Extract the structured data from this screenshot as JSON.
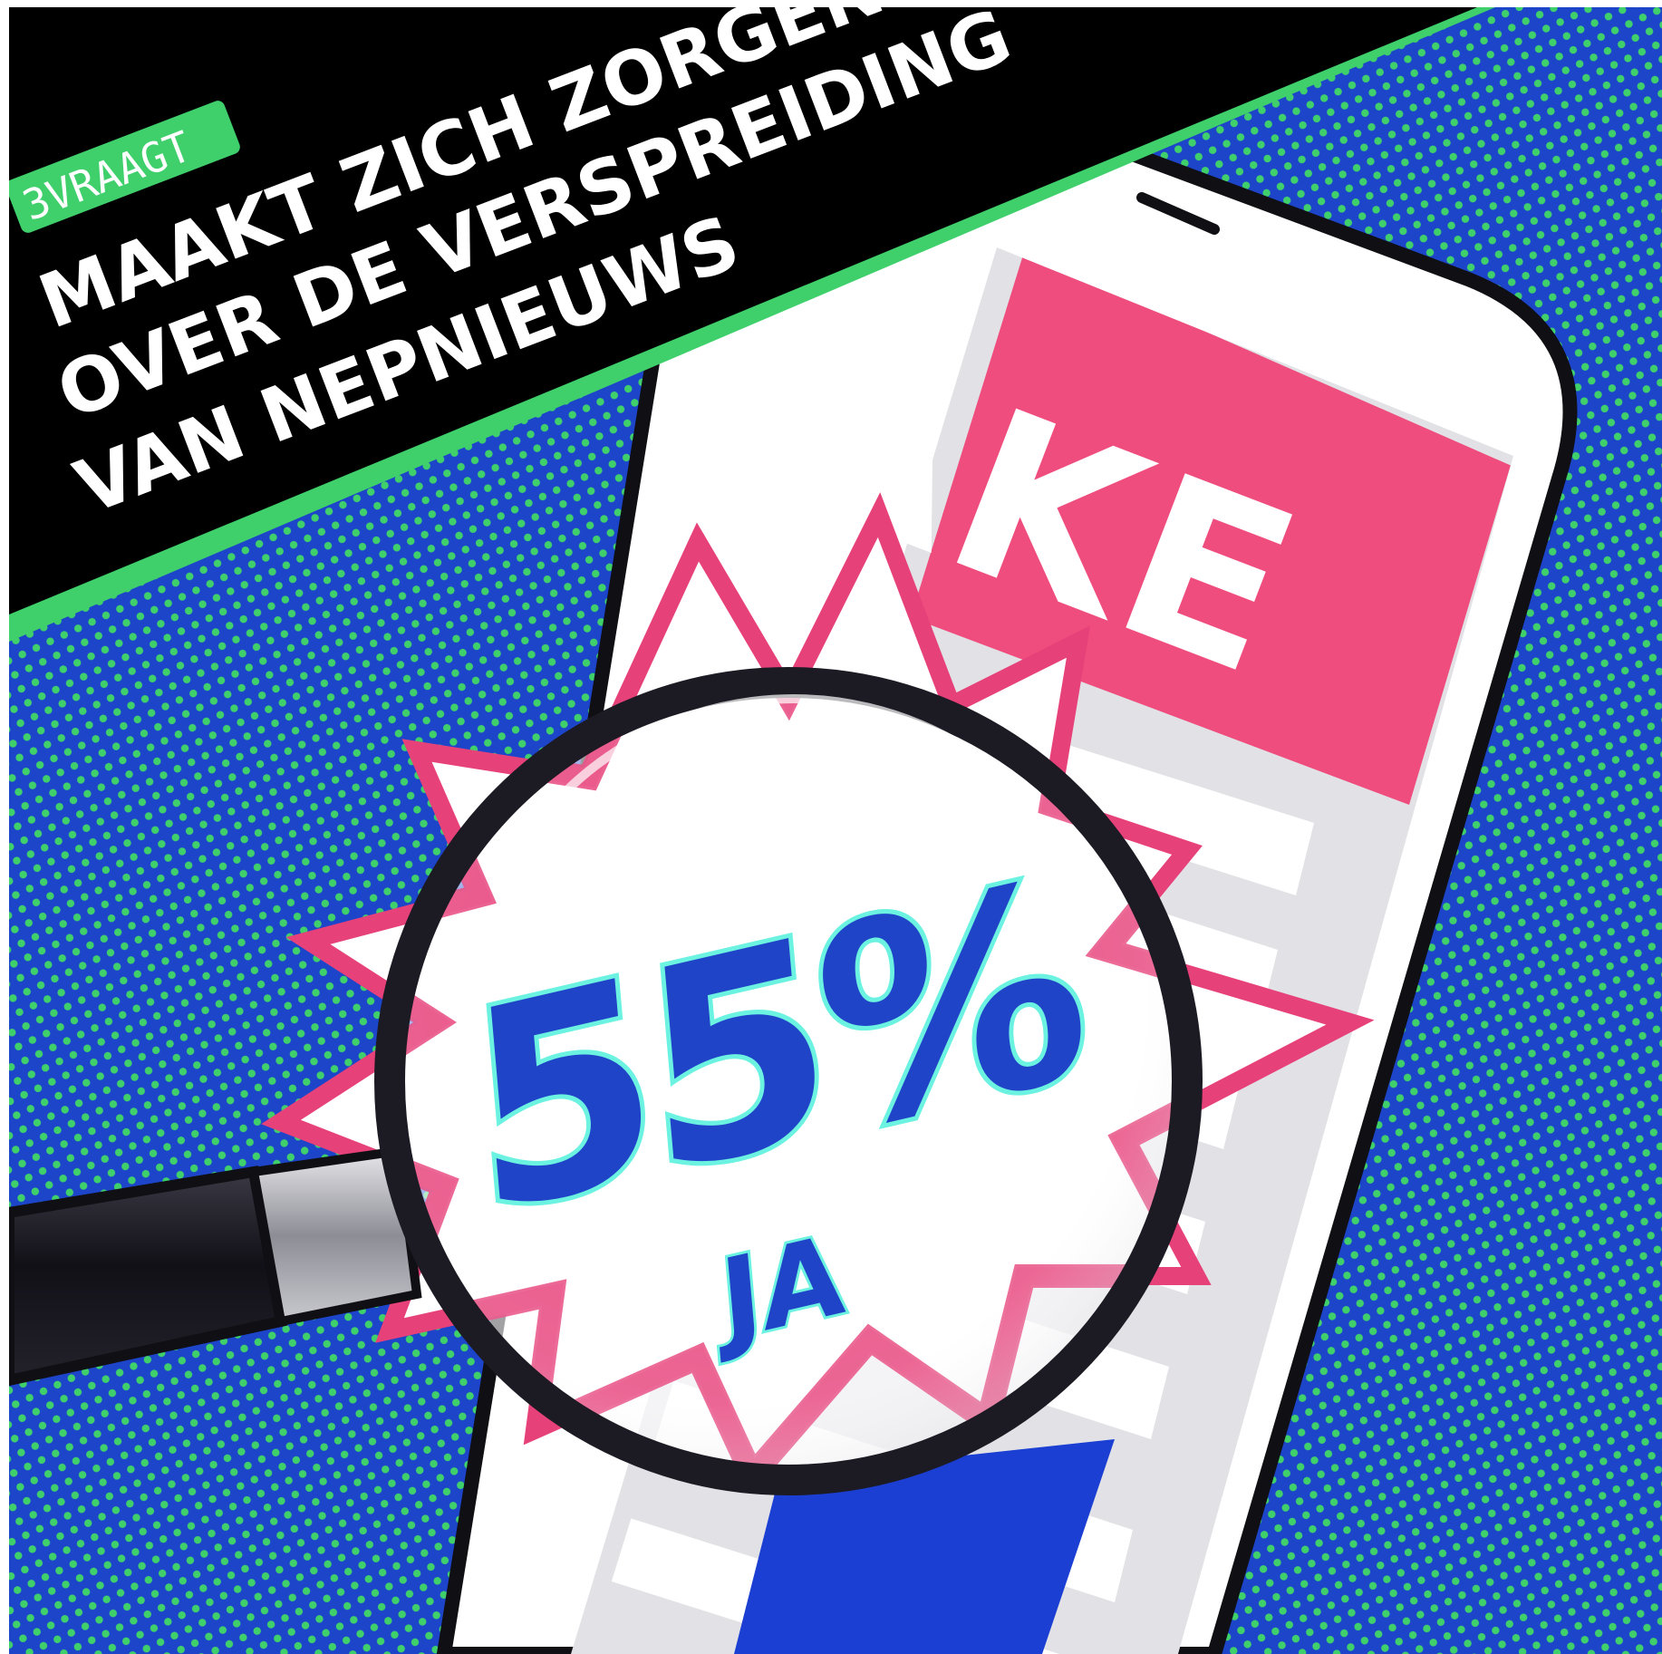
{
  "banner": {
    "tag": "3VRAAGT",
    "lines": [
      "MAAKT ZICH ZORGEN",
      "OVER DE VERSPREIDING",
      "VAN NEPNIEUWS"
    ]
  },
  "phone": {
    "headline": "FAKE"
  },
  "result": {
    "percentage": "55%",
    "answer": "JA"
  },
  "colors": {
    "background_blue": "#1d45c9",
    "dot_green": "#3fd06c",
    "banner_black": "#000000",
    "accent_green": "#3fd06c",
    "fake_pink": "#ef4d7e",
    "burst_pink": "#e7417a",
    "number_blue": "#1f44c8",
    "number_outline": "#6cf2e0",
    "handle_black": "#1c1b24"
  },
  "icons": {
    "magnifier": "magnifying-glass-icon",
    "phone": "smartphone-icon",
    "burst": "starburst-icon"
  }
}
